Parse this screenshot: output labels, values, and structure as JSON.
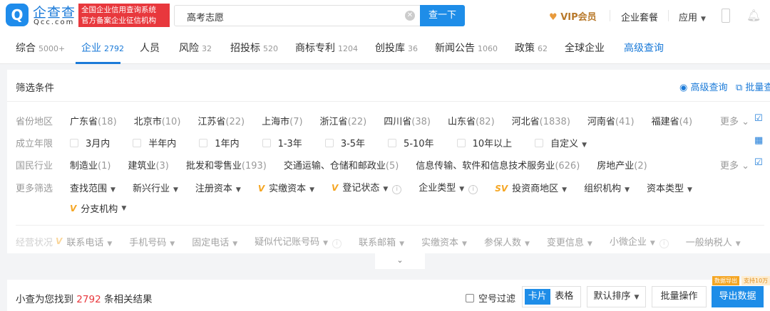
{
  "header": {
    "logo_text": "企查查",
    "logo_domain": "Qcc.com",
    "badge_line1": "全国企业信用查询系统",
    "badge_line2": "官方备案企业征信机构",
    "search_value": "高考志愿",
    "search_button": "查一下",
    "vip_label": "VIP会员",
    "package_label": "企业套餐",
    "apps_label": "应用"
  },
  "tabs": [
    {
      "label": "综合",
      "count": "5000+"
    },
    {
      "label": "企业",
      "count": "2792"
    },
    {
      "label": "人员",
      "count": ""
    },
    {
      "label": "风险",
      "count": "32"
    },
    {
      "label": "招投标",
      "count": "520"
    },
    {
      "label": "商标专利",
      "count": "1204"
    },
    {
      "label": "创投库",
      "count": "36"
    },
    {
      "label": "新闻公告",
      "count": "1060"
    },
    {
      "label": "政策",
      "count": "62"
    },
    {
      "label": "全球企业",
      "count": ""
    },
    {
      "label": "高级查询",
      "count": ""
    }
  ],
  "filter": {
    "title": "筛选条件",
    "advanced_query": "高级查询",
    "batch_query": "批量查",
    "more": "更多",
    "region_label": "省份地区",
    "regions": [
      {
        "name": "广东省",
        "count": "(18)"
      },
      {
        "name": "北京市",
        "count": "(10)"
      },
      {
        "name": "江苏省",
        "count": "(22)"
      },
      {
        "name": "上海市",
        "count": "(7)"
      },
      {
        "name": "浙江省",
        "count": "(22)"
      },
      {
        "name": "四川省",
        "count": "(38)"
      },
      {
        "name": "山东省",
        "count": "(82)"
      },
      {
        "name": "河北省",
        "count": "(1838)"
      },
      {
        "name": "河南省",
        "count": "(41)"
      },
      {
        "name": "福建省",
        "count": "(4)"
      }
    ],
    "age_label": "成立年限",
    "ages": [
      "3月内",
      "半年内",
      "1年内",
      "1-3年",
      "3-5年",
      "5-10年",
      "10年以上"
    ],
    "custom": "自定义",
    "industry_label": "国民行业",
    "industries": [
      {
        "name": "制造业",
        "count": "(1)"
      },
      {
        "name": "建筑业",
        "count": "(3)"
      },
      {
        "name": "批发和零售业",
        "count": "(193)"
      },
      {
        "name": "交通运输、仓储和邮政业",
        "count": "(5)"
      },
      {
        "name": "信息传输、软件和信息技术服务业",
        "count": "(626)"
      },
      {
        "name": "房地产业",
        "count": "(2)"
      }
    ],
    "more_label": "更多筛选",
    "more_filters": [
      {
        "name": "查找范围",
        "vip": "",
        "info": false
      },
      {
        "name": "新兴行业",
        "vip": "",
        "info": false
      },
      {
        "name": "注册资本",
        "vip": "",
        "info": false
      },
      {
        "name": "实缴资本",
        "vip": "V",
        "info": false
      },
      {
        "name": "登记状态",
        "vip": "V",
        "info": true
      },
      {
        "name": "企业类型",
        "vip": "",
        "info": true
      },
      {
        "name": "投资商地区",
        "vip": "SV",
        "info": false
      },
      {
        "name": "组织机构",
        "vip": "",
        "info": false
      },
      {
        "name": "资本类型",
        "vip": "",
        "info": false
      }
    ],
    "branch": {
      "name": "分支机构",
      "vip": "V"
    },
    "business_label": "经营状况",
    "business_filters": [
      {
        "name": "联系电话",
        "info": false
      },
      {
        "name": "手机号码",
        "info": false
      },
      {
        "name": "固定电话",
        "info": false
      },
      {
        "name": "疑似代记账号码",
        "info": true
      },
      {
        "name": "联系邮箱",
        "info": false
      },
      {
        "name": "实缴资本",
        "info": false
      },
      {
        "name": "参保人数",
        "info": false
      },
      {
        "name": "变更信息",
        "info": false
      },
      {
        "name": "小微企业",
        "info": true
      },
      {
        "name": "一般纳税人",
        "info": false
      }
    ]
  },
  "results": {
    "prefix": "小查为您找到",
    "count": "2792",
    "suffix": "条相关结果",
    "empty_filter": "空号过滤",
    "view_card": "卡片",
    "view_table": "表格",
    "sort": "默认排序",
    "batch": "批量操作",
    "export": "导出数据",
    "export_tag": "数据导出",
    "export_tip": "支持10万"
  }
}
